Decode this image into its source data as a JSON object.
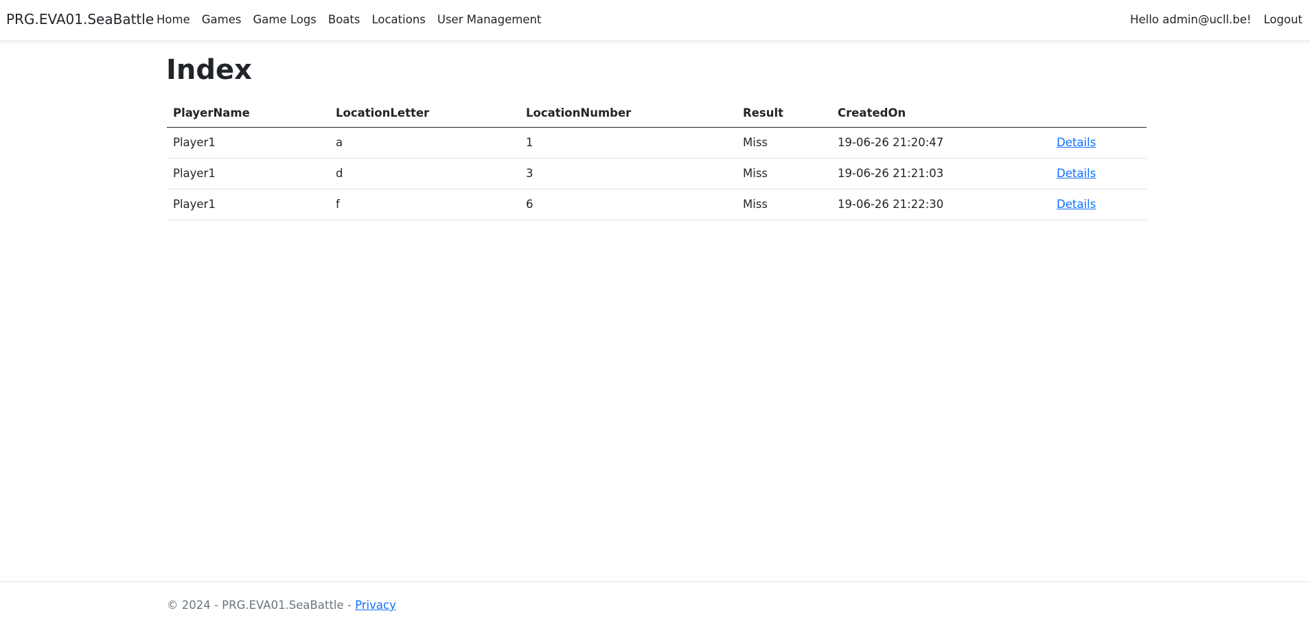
{
  "navbar": {
    "brand": "PRG.EVA01.SeaBattle",
    "links": [
      "Home",
      "Games",
      "Game Logs",
      "Boats",
      "Locations",
      "User Management"
    ],
    "greeting": "Hello admin@ucll.be!",
    "logout": "Logout"
  },
  "main": {
    "title": "Index",
    "table": {
      "headers": [
        "PlayerName",
        "LocationLetter",
        "LocationNumber",
        "Result",
        "CreatedOn",
        ""
      ],
      "rows": [
        {
          "player": "Player1",
          "letter": "a",
          "number": "1",
          "result": "Miss",
          "created": "19-06-26 21:20:47",
          "action": "Details"
        },
        {
          "player": "Player1",
          "letter": "d",
          "number": "3",
          "result": "Miss",
          "created": "19-06-26 21:21:03",
          "action": "Details"
        },
        {
          "player": "Player1",
          "letter": "f",
          "number": "6",
          "result": "Miss",
          "created": "19-06-26 21:22:30",
          "action": "Details"
        }
      ]
    }
  },
  "footer": {
    "copyright": "© 2024 - PRG.EVA01.SeaBattle - ",
    "privacy": "Privacy"
  },
  "colors": {
    "link": "#0d6efd",
    "text": "#212529",
    "muted": "#6c757d",
    "border": "#dee2e6"
  }
}
